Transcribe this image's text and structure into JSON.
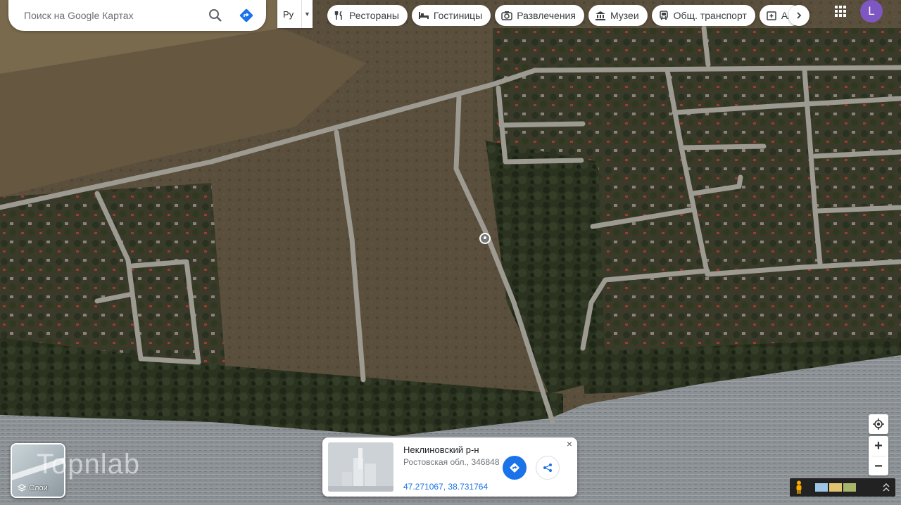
{
  "search": {
    "placeholder": "Поиск на Google Картах"
  },
  "language": {
    "selected": "Ру"
  },
  "categories": [
    {
      "label": "Рестораны",
      "icon": "fork-knife-icon"
    },
    {
      "label": "Гостиницы",
      "icon": "bed-icon"
    },
    {
      "label": "Развлечения",
      "icon": "camera-icon"
    },
    {
      "label": "Музеи",
      "icon": "museum-icon"
    },
    {
      "label": "Общ. транспорт",
      "icon": "bus-icon"
    },
    {
      "label": "Ап",
      "icon": "pharmacy-icon"
    }
  ],
  "account": {
    "initial": "L",
    "color": "#7e57c2"
  },
  "layers": {
    "label": "Слои"
  },
  "watermark": "Topnlab",
  "place_card": {
    "title": "Неклиновский р-н",
    "subtitle": "Ростовская обл., 346848",
    "coordinates": "47.271067, 38.731764",
    "close": "×"
  },
  "zoom": {
    "in": "+",
    "out": "−"
  },
  "colors": {
    "accent": "#1a73e8",
    "avatar": "#7e57c2",
    "water": "#8a8f93"
  }
}
